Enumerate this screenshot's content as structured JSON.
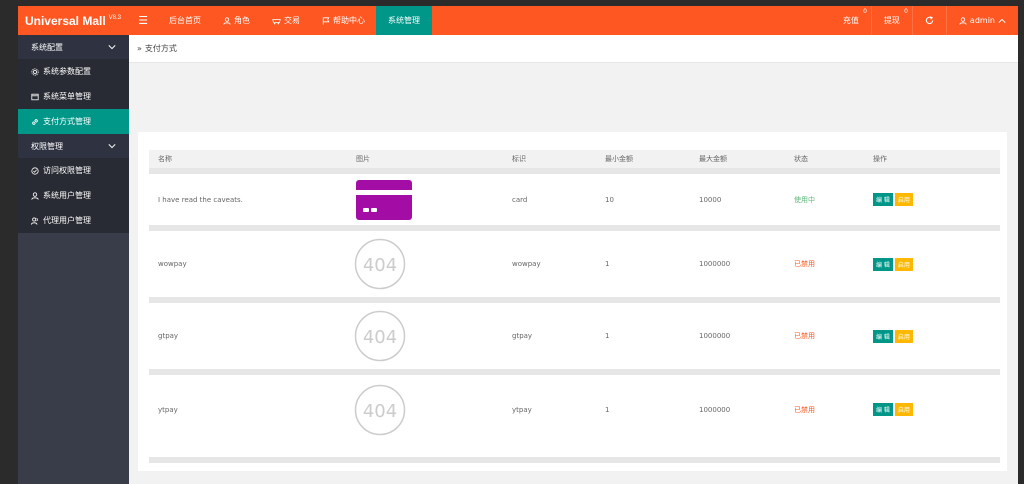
{
  "header": {
    "logo": "Universal Mall",
    "version": "V8.3",
    "nav": [
      {
        "label": "后台首页",
        "icon": ""
      },
      {
        "label": "角色",
        "icon": "user-icon"
      },
      {
        "label": "交易",
        "icon": "cart-icon"
      },
      {
        "label": "帮助中心",
        "icon": "flag-icon"
      },
      {
        "label": "系统管理",
        "icon": ""
      }
    ],
    "right": {
      "recharge": "充值",
      "recharge_badge": "0",
      "withdraw": "提现",
      "withdraw_badge": "0",
      "user": "admin"
    }
  },
  "sidebar": {
    "group1": "系统配置",
    "items1": [
      "系统参数配置",
      "系统菜单管理",
      "支付方式管理"
    ],
    "group2": "权限管理",
    "items2": [
      "访问权限管理",
      "系统用户管理",
      "代理用户管理"
    ]
  },
  "breadcrumb": "支付方式",
  "table": {
    "headers": [
      "名称",
      "图片",
      "标识",
      "最小金额",
      "最大金额",
      "状态",
      "操作"
    ],
    "rows": [
      {
        "name": "I have read the caveats.",
        "image": "card",
        "code": "card",
        "min": "10",
        "max": "10000",
        "status": "使用中",
        "active": true
      },
      {
        "name": "wowpay",
        "image": "404",
        "code": "wowpay",
        "min": "1",
        "max": "1000000",
        "status": "已禁用",
        "active": false
      },
      {
        "name": "gtpay",
        "image": "404",
        "code": "gtpay",
        "min": "1",
        "max": "1000000",
        "status": "已禁用",
        "active": false
      },
      {
        "name": "ytpay",
        "image": "404",
        "code": "ytpay",
        "min": "1",
        "max": "1000000",
        "status": "已禁用",
        "active": false
      }
    ],
    "edit_label": "编 辑",
    "disable_label": "启用",
    "img_404_text": "404"
  },
  "colors": {
    "header": "#ff5722",
    "accent": "#009688",
    "sidebar": "#393d49"
  }
}
